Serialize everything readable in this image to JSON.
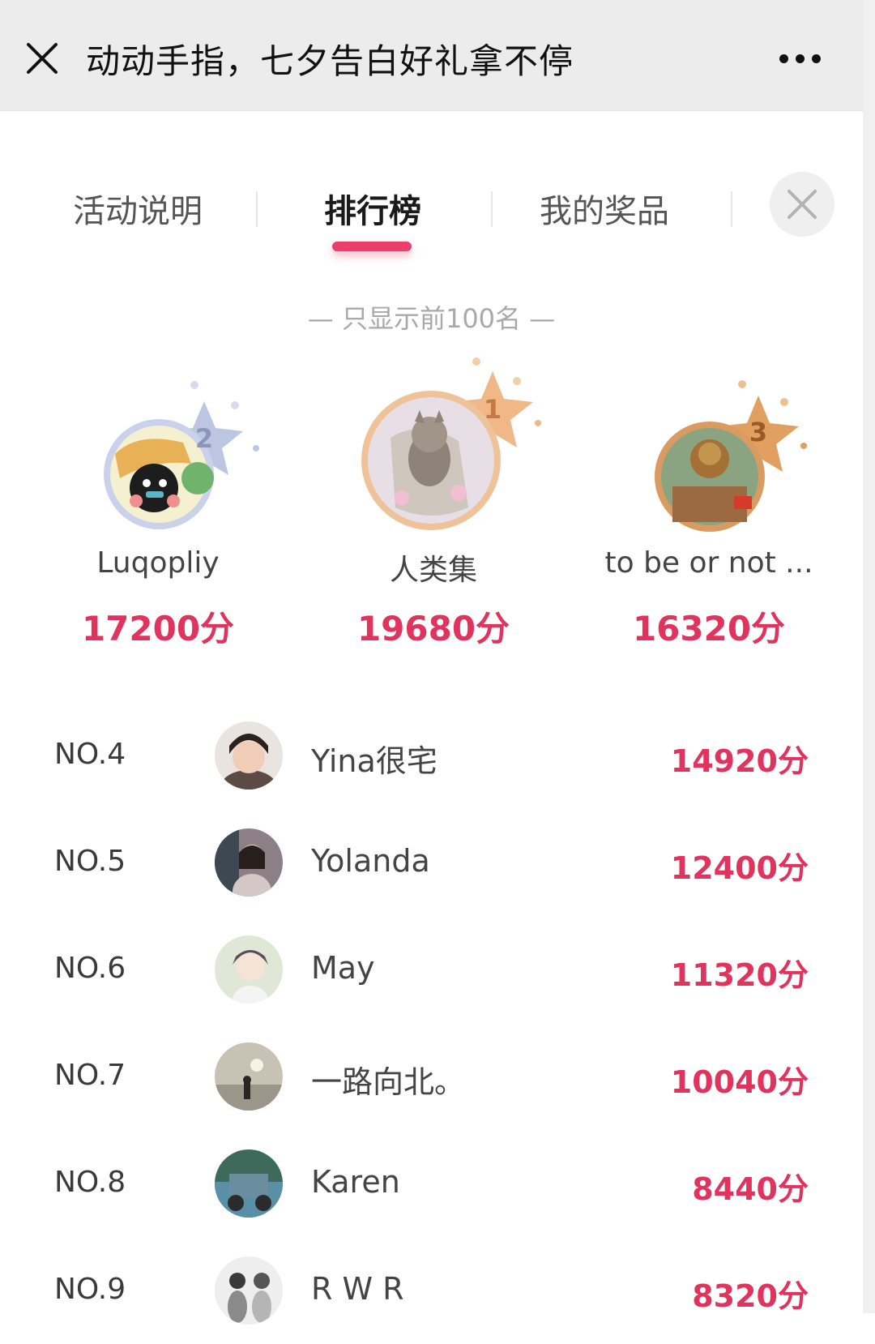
{
  "titlebar": {
    "title": "动动手指，七夕告白好礼拿不停",
    "close_icon": "close-icon",
    "more_icon": "more-icon"
  },
  "tabs": [
    {
      "label": "活动说明",
      "active": false
    },
    {
      "label": "排行榜",
      "active": true
    },
    {
      "label": "我的奖品",
      "active": false
    }
  ],
  "notice": "— 只显示前100名 —",
  "accent_color": "#e0345f",
  "podium": [
    {
      "rank": "2",
      "name": "Luqopliy",
      "score": "17200分",
      "medal": "silver"
    },
    {
      "rank": "1",
      "name": "人类集",
      "score": "19680分",
      "medal": "gold"
    },
    {
      "rank": "3",
      "name": "to be or not ...",
      "score": "16320分",
      "medal": "bronze"
    }
  ],
  "ranking": [
    {
      "rank": "NO.4",
      "name": "Yina很宅",
      "score": "14920分"
    },
    {
      "rank": "NO.5",
      "name": "Yolanda",
      "score": "12400分"
    },
    {
      "rank": "NO.6",
      "name": "May",
      "score": "11320分"
    },
    {
      "rank": "NO.7",
      "name": "一路向北。",
      "score": "10040分"
    },
    {
      "rank": "NO.8",
      "name": "Karen",
      "score": "8440分"
    },
    {
      "rank": "NO.9",
      "name": "R W R",
      "score": "8320分"
    }
  ]
}
